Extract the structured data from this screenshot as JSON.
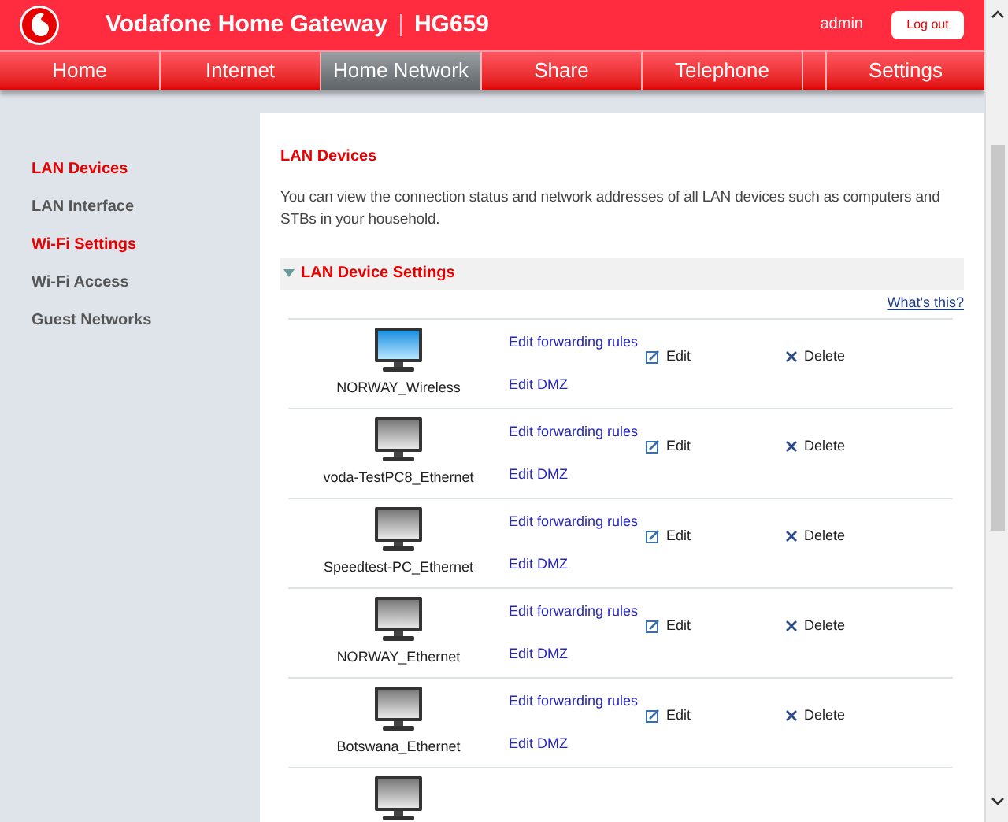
{
  "header": {
    "brand": "Vodafone Home Gateway",
    "model": "HG659",
    "user": "admin",
    "logout": "Log out"
  },
  "tabs": [
    {
      "label": "Home",
      "selected": false
    },
    {
      "label": "Internet",
      "selected": false
    },
    {
      "label": "Home Network",
      "selected": true
    },
    {
      "label": "Share",
      "selected": false
    },
    {
      "label": "Telephone",
      "selected": false
    },
    {
      "label": "Settings",
      "selected": false
    }
  ],
  "sidebar": {
    "items": [
      {
        "label": "LAN Devices",
        "selected": true
      },
      {
        "label": "LAN Interface",
        "selected": false
      },
      {
        "label": "Wi-Fi Settings",
        "selected": true
      },
      {
        "label": "Wi-Fi Access",
        "selected": false
      },
      {
        "label": "Guest Networks",
        "selected": false
      }
    ]
  },
  "content": {
    "title": "LAN Devices",
    "description": "You can view the connection status and network addresses of all LAN devices such as computers and STBs in your household.",
    "section": {
      "title": "LAN Device Settings",
      "expanded": true
    },
    "help_link": "What's this?"
  },
  "devices": [
    {
      "name": "NORWAY_Wireless",
      "online": true,
      "forwarding": "Edit forwarding rules",
      "dmz": "Edit DMZ",
      "edit": "Edit",
      "delete": "Delete"
    },
    {
      "name": "voda-TestPC8_Ethernet",
      "online": false,
      "forwarding": "Edit forwarding rules",
      "dmz": "Edit DMZ",
      "edit": "Edit",
      "delete": "Delete"
    },
    {
      "name": "Speedtest-PC_Ethernet",
      "online": false,
      "forwarding": "Edit forwarding rules",
      "dmz": "Edit DMZ",
      "edit": "Edit",
      "delete": "Delete"
    },
    {
      "name": "NORWAY_Ethernet",
      "online": false,
      "forwarding": "Edit forwarding rules",
      "dmz": "Edit DMZ",
      "edit": "Edit",
      "delete": "Delete"
    },
    {
      "name": "Botswana_Ethernet",
      "online": false,
      "forwarding": "Edit forwarding rules",
      "dmz": "Edit DMZ",
      "edit": "Edit",
      "delete": "Delete"
    }
  ]
}
